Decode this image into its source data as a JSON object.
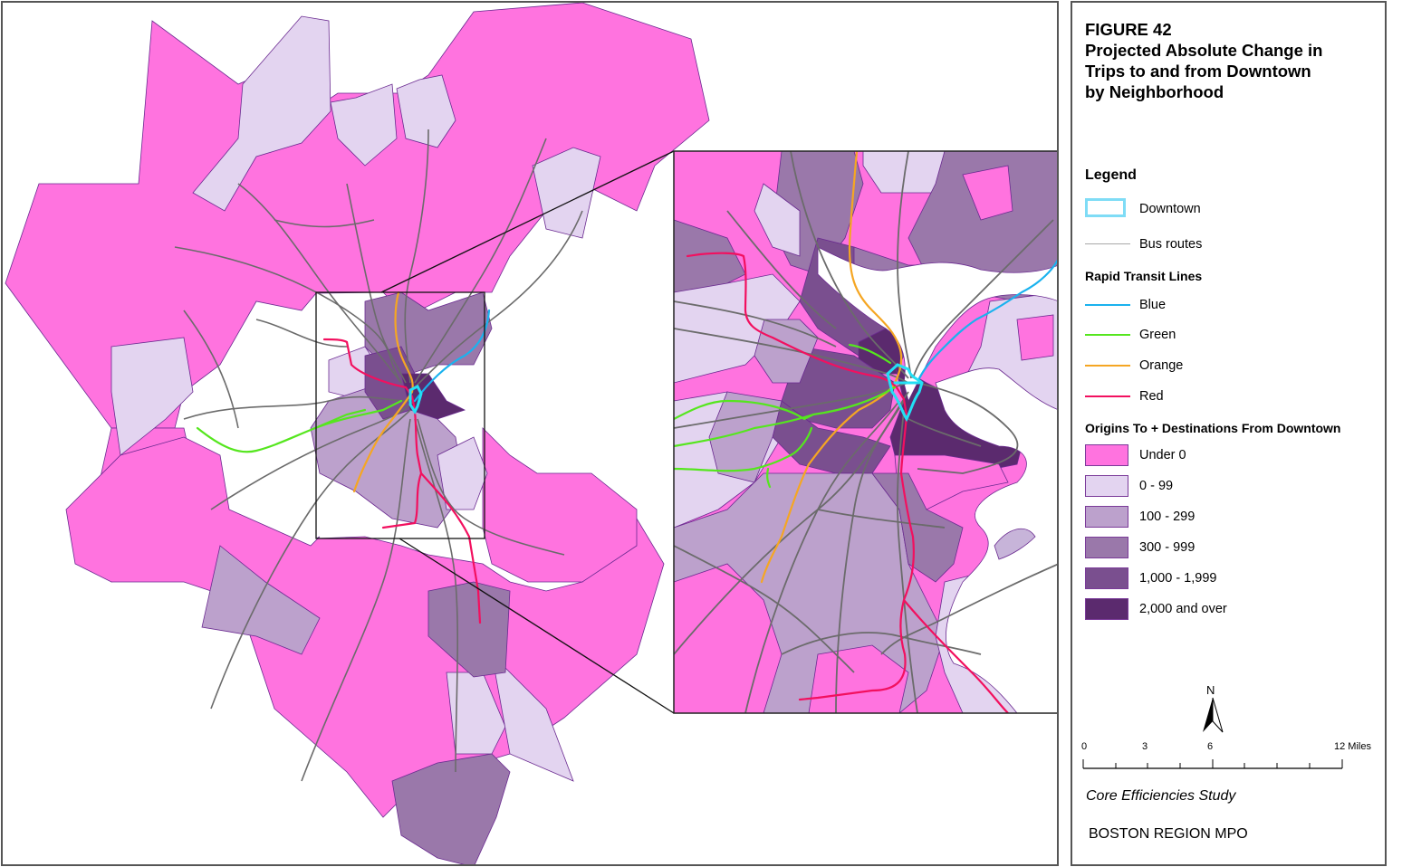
{
  "figure": {
    "number_label": "FIGURE 42",
    "title_lines": [
      "Projected Absolute Change in",
      "Trips to and from Downtown",
      "by Neighborhood"
    ]
  },
  "legend": {
    "heading": "Legend",
    "downtown": {
      "label": "Downtown",
      "color": "#7fdcf6"
    },
    "bus_routes": {
      "label": "Bus routes",
      "color": "#6b6b6b"
    },
    "rapid_transit": {
      "heading": "Rapid Transit Lines",
      "lines": [
        {
          "label": "Blue",
          "color": "#1ab2ee"
        },
        {
          "label": "Green",
          "color": "#55e61e"
        },
        {
          "label": "Orange",
          "color": "#f5a623"
        },
        {
          "label": "Red",
          "color": "#f2105f"
        }
      ]
    },
    "classes": {
      "heading": "Origins To + Destinations From Downtown",
      "items": [
        {
          "label": "Under 0",
          "color": "#ff73df"
        },
        {
          "label": "0 - 99",
          "color": "#e3d4f0"
        },
        {
          "label": "100 - 299",
          "color": "#bca1cc"
        },
        {
          "label": "300 - 999",
          "color": "#9a78aa"
        },
        {
          "label": "1,000 - 1,999",
          "color": "#7a4f8f"
        },
        {
          "label": "2,000 and over",
          "color": "#5b2a6e"
        }
      ]
    }
  },
  "north_arrow": {
    "label": "N"
  },
  "scale_bar": {
    "labels": [
      "0",
      "3",
      "6",
      "12 Miles"
    ],
    "units": "Miles",
    "max": 12
  },
  "credits": {
    "study": "Core Efficiencies Study",
    "org": "BOSTON REGION MPO"
  }
}
